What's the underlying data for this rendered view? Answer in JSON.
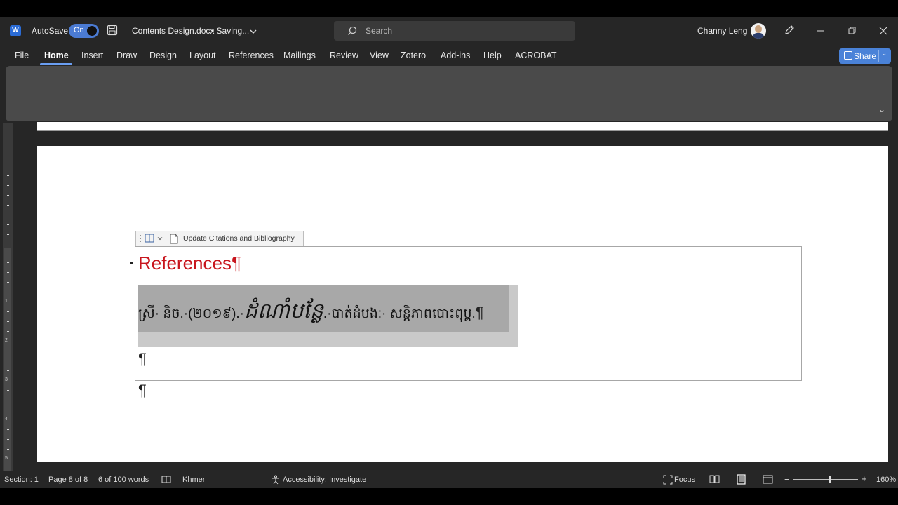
{
  "titlebar": {
    "app_logo": "W",
    "autosave_label": "AutoSave",
    "autosave_state": "On",
    "doc_title": "Contents Design.docx",
    "save_status": "• Saving...",
    "search_placeholder": "Search",
    "user_name": "Channy Leng",
    "icons": [
      "word-logo-icon",
      "save-icon",
      "chevron-down-icon",
      "search-icon",
      "pen-icon",
      "minimize-icon",
      "restore-icon",
      "close-icon"
    ]
  },
  "ribbon": {
    "tabs": [
      "File",
      "Home",
      "Insert",
      "Draw",
      "Design",
      "Layout",
      "References",
      "Mailings",
      "Review",
      "View",
      "Zotero",
      "Add-ins",
      "Help",
      "ACROBAT"
    ],
    "active_tab": "Home",
    "share_label": "Share"
  },
  "ruler": {
    "numbers": [
      "1",
      "2",
      "3",
      "4",
      "5"
    ]
  },
  "document": {
    "citation_tab_label": "Update Citations and Bibliography",
    "heading": "References",
    "pilcrow": "¶",
    "bib_entry_author": "ស្រី· និច.·(២០១៩).·",
    "bib_entry_title": "ដំណាំបន្លែ",
    "bib_entry_rest": ".·បាត់ដំបង:· សន្តិភាពបោះពុម្ព.",
    "colors": {
      "heading": "#c8161e",
      "highlight": "#a8a8a8"
    }
  },
  "status": {
    "section": "Section: 1",
    "page": "Page 8 of 8",
    "words": "6 of 100 words",
    "language": "Khmer",
    "accessibility": "Accessibility: Investigate",
    "focus": "Focus",
    "zoom_level": "160%",
    "zoom_minus": "−",
    "zoom_plus": "+"
  }
}
